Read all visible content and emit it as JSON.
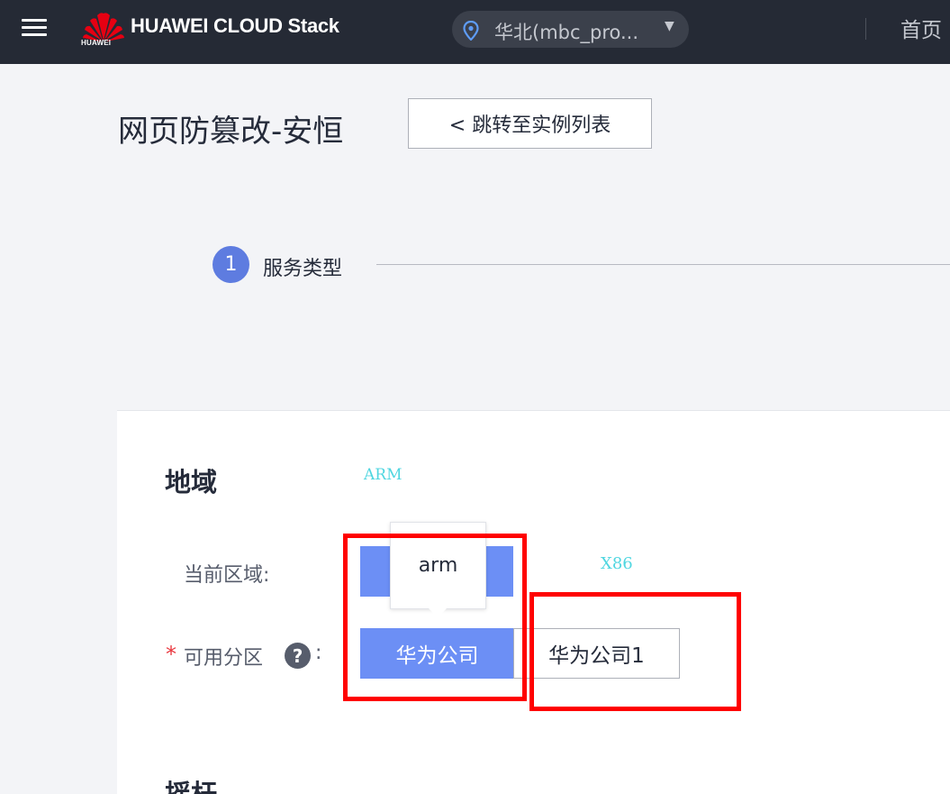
{
  "header": {
    "brand": "HUAWEI CLOUD Stack",
    "logo_text": "HUAWEI",
    "region": "华北(mbc_pro...",
    "home": "首页",
    "icons": {
      "menu": "hamburger-menu-icon",
      "region": "location-pin-icon",
      "region_caret": "caret-down-icon"
    }
  },
  "page": {
    "title": "网页防篡改-安恒",
    "back_button": "< 跳转至实例列表"
  },
  "steps": [
    {
      "number": "1",
      "label": "服务类型"
    }
  ],
  "region_section": {
    "title": "地域",
    "current_region_label": "当前区域:",
    "tooltip": "arm",
    "az_required": "*",
    "az_label": "可用分区",
    "az_help_icon": "?",
    "az_colon": ":",
    "az_options": [
      "华为公司",
      "华为公司1"
    ],
    "az_selected": "华为公司"
  },
  "annotations": {
    "arm": "ARM",
    "x86": "X86",
    "highlight_color": "#ff0000",
    "annotation_color": "#4fd6e0"
  },
  "next_section": {
    "title": "摇杆"
  },
  "colors": {
    "primary": "#6c8ff5",
    "step": "#5e7ce0",
    "topbar": "#252a35"
  }
}
